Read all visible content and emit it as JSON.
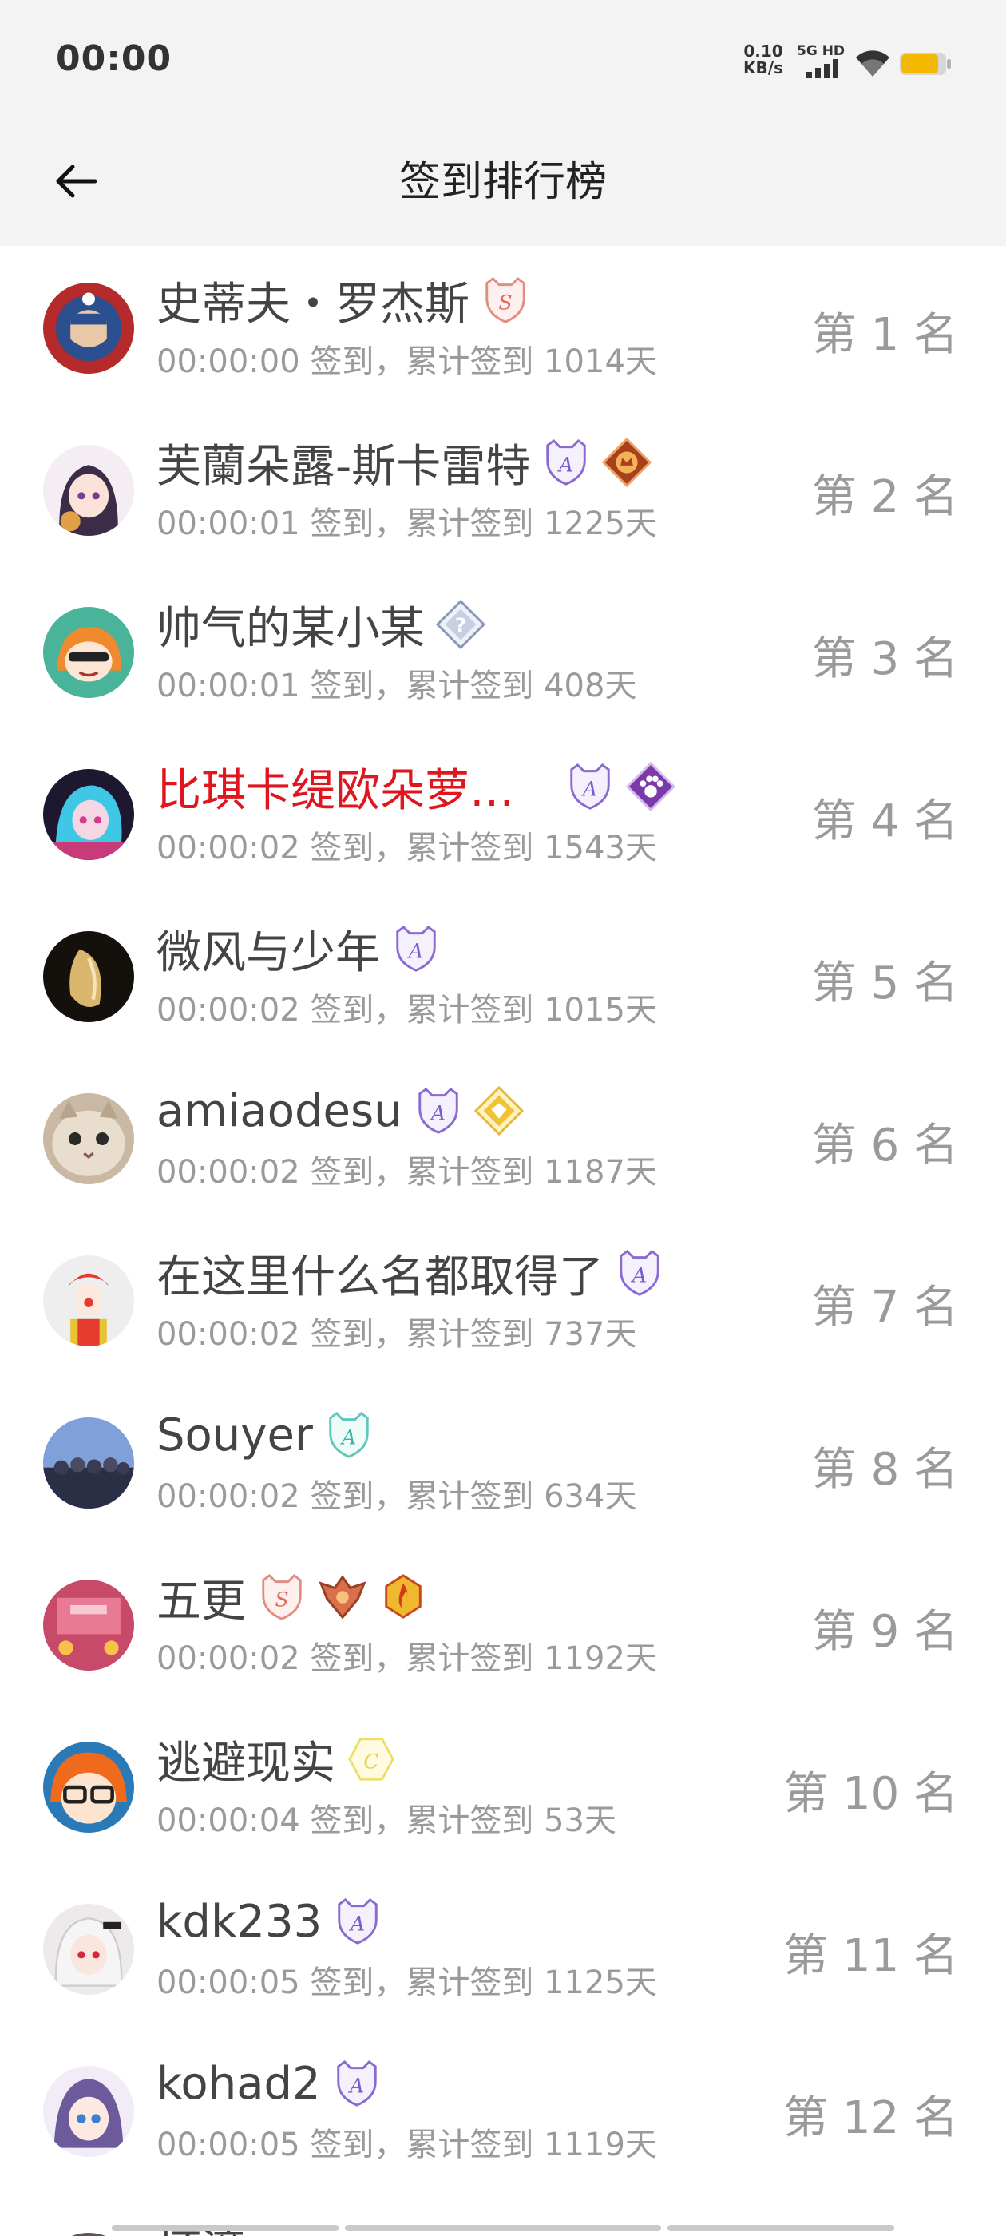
{
  "status_bar": {
    "time": "00:00",
    "net_speed_value": "0.10",
    "net_speed_unit": "KB/s",
    "signal_label": "5G HD",
    "battery_color": "#f5b800"
  },
  "header": {
    "title": "签到排行榜",
    "back_icon": "arrow-left-icon"
  },
  "ranking": [
    {
      "name": "史蒂夫・罗杰斯",
      "name_color": "#444444",
      "time": "00:00:00",
      "total": "1014",
      "rank": "1",
      "badges": [
        "medal-s-pink"
      ],
      "avatar": "captain-america"
    },
    {
      "name": "芙蘭朵露-斯卡雷特",
      "name_color": "#444444",
      "time": "00:00:01",
      "total": "1225",
      "rank": "2",
      "badges": [
        "medal-a-purple",
        "medal-crown-orange"
      ],
      "avatar": "anime-girl-dark-hair"
    },
    {
      "name": "帅气的某小某",
      "name_color": "#444444",
      "time": "00:00:01",
      "total": "408",
      "rank": "3",
      "badges": [
        "medal-question-gray"
      ],
      "avatar": "anime-sunglasses"
    },
    {
      "name": "比琪卡缇欧朵萝…",
      "name_color": "#e0161e",
      "time": "00:00:02",
      "total": "1543",
      "rank": "4",
      "badges": [
        "medal-a-purple",
        "medal-paw-purple"
      ],
      "avatar": "anime-blue-hair"
    },
    {
      "name": "微风与少年",
      "name_color": "#444444",
      "time": "00:00:02",
      "total": "1015",
      "rank": "5",
      "badges": [
        "medal-a-purple"
      ],
      "avatar": "dark-art"
    },
    {
      "name": "amiaodesu",
      "name_color": "#444444",
      "time": "00:00:02",
      "total": "1187",
      "rank": "6",
      "badges": [
        "medal-a-purple",
        "medal-gold-diamond"
      ],
      "avatar": "cat-face"
    },
    {
      "name": "在这里什么名都取得了",
      "name_color": "#444444",
      "time": "00:00:02",
      "total": "737",
      "rank": "7",
      "badges": [
        "medal-a-purple"
      ],
      "avatar": "clown"
    },
    {
      "name": "Souyer",
      "name_color": "#444444",
      "time": "00:00:02",
      "total": "634",
      "rank": "8",
      "badges": [
        "medal-a-teal"
      ],
      "avatar": "group-photo"
    },
    {
      "name": "五更",
      "name_color": "#444444",
      "time": "00:00:02",
      "total": "1192",
      "rank": "9",
      "badges": [
        "medal-s-pink",
        "medal-wings-bronze",
        "medal-flame-gold"
      ],
      "avatar": "pink-street"
    },
    {
      "name": "逃避现实",
      "name_color": "#444444",
      "time": "00:00:04",
      "total": "53",
      "rank": "10",
      "badges": [
        "medal-c-yellow"
      ],
      "avatar": "orange-hair-glasses"
    },
    {
      "name": "kdk233",
      "name_color": "#444444",
      "time": "00:00:05",
      "total": "1125",
      "rank": "11",
      "badges": [
        "medal-a-purple"
      ],
      "avatar": "white-hair-girl"
    },
    {
      "name": "kohad2",
      "name_color": "#444444",
      "time": "00:00:05",
      "total": "1119",
      "rank": "12",
      "badges": [
        "medal-a-purple"
      ],
      "avatar": "purple-hair-girl"
    }
  ],
  "partial_row_name": "坏滴",
  "labels": {
    "checkin_sep": " 签到，累计签到 ",
    "days_suffix": "天",
    "rank_prefix": "第 ",
    "rank_suffix": " 名"
  }
}
